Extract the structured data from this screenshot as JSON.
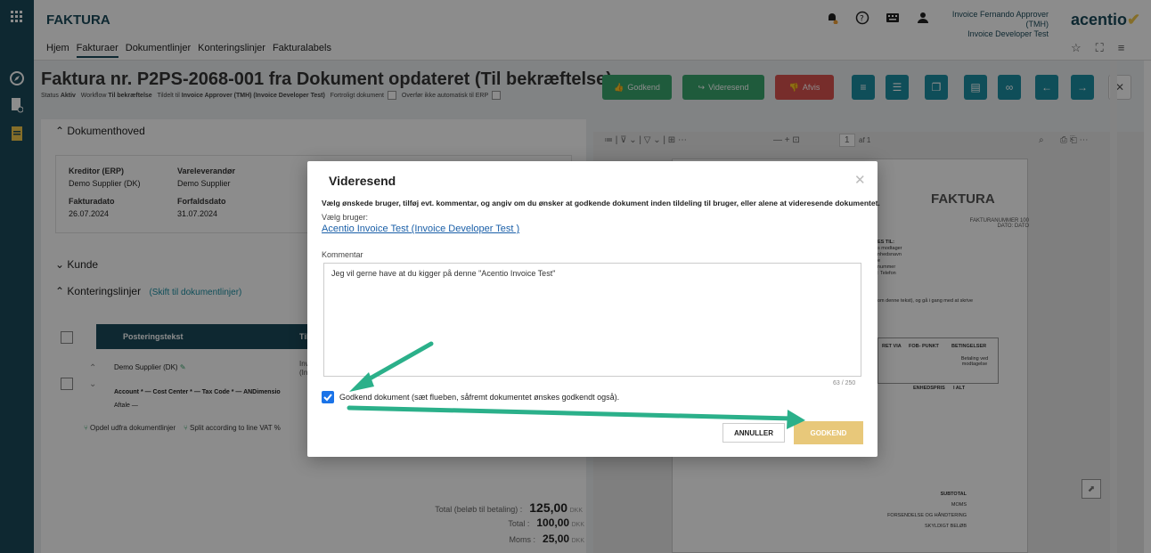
{
  "app": {
    "title": "FAKTURA",
    "logo_main": "acentio",
    "user_line1": "Invoice Fernando Approver (TMH)",
    "user_line2": "Invoice Developer Test"
  },
  "nav": [
    "Hjem",
    "Fakturaer",
    "Dokumentlinjer",
    "Konteringslinjer",
    "Fakturalabels"
  ],
  "doc": {
    "title": "Faktura nr. P2PS-2068-001 fra Dokument opdateret (Til bekræftelse)",
    "status_label": "Status",
    "status_value": "Aktiv",
    "workflow_label": "Workflow",
    "workflow_value": "Til bekræftelse",
    "assigned_label": "Tildelt til",
    "assigned_value": "Invoice Approver (TMH) (Invoice Developer Test)",
    "confidential": "Fortroligt dokument",
    "no_erp": "Overfør ikke automatisk til ERP"
  },
  "toolbar": {
    "approve": "Godkend",
    "forward": "Videresend",
    "reject": "Afvis"
  },
  "header_section": {
    "title": "Dokumenthoved",
    "creditor_label": "Kreditor (ERP)",
    "creditor_value": "Demo Supplier (DK)",
    "supplier_label": "Vareleverandør",
    "supplier_value": "Demo Supplier",
    "invoice_date_label": "Fakturadato",
    "invoice_date_value": "26.07.2024",
    "due_date_label": "Forfaldsdato",
    "due_date_value": "31.07.2024"
  },
  "customer_section": {
    "title": "Kunde"
  },
  "lines_section": {
    "title": "Konteringslinjer",
    "switch_link": "(Skift til dokumentlinjer)",
    "col_posting": "Posteringstekst",
    "col_tild": "Tild",
    "row_text": "Demo Supplier (DK)",
    "row_inv1": "Invo",
    "row_inv2": "(Invo",
    "row_fields": "Account * — Cost Center * — Tax Code * — ANDimensio",
    "row_aftale": "Aftale —",
    "split1": "Opdel udfra dokumentlinjer",
    "split2": "Split according to line VAT %"
  },
  "totals": {
    "total_label": "Total :",
    "total_value": "100,00",
    "total_cur": "DKK",
    "vat_label": "Moms :",
    "vat_value": "25,00",
    "vat_cur": "DKK",
    "grand_label": "Total (beløb til betaling) :",
    "grand_value": "125,00",
    "grand_cur": "DKK"
  },
  "pdf": {
    "page": "1",
    "of": "af 1",
    "heading": "FAKTURA",
    "invoice_no": "FAKTURANUMMER 100",
    "date": "DATO: DATO",
    "ship_label": "ES TIL:",
    "ship_lines": [
      "s modtager",
      "nhedsnavn",
      "e",
      "nummer",
      ": Telefon"
    ],
    "note": "om denne tekst), og gå i gang med at skrive",
    "col_via": "RET VIA",
    "col_fob": "FOB- PUNKT",
    "col_terms": "BETINGELSER",
    "terms_value": "Betaling ved modtagelse",
    "col_unit": "ENHEDSPRIS",
    "col_total": "I ALT",
    "subtotal": "SUBTOTAL",
    "moms": "MOMS",
    "shipping": "FORSENDELSE OG HÅNDTERING",
    "due": "SKYLDIGT BELØB"
  },
  "modal": {
    "title": "Videresend",
    "instruction": "Vælg ønskede bruger, tilføj evt. kommentar, og angiv om du ønsker at godkende dokument inden tildeling til bruger, eller alene at videresende dokumentet.",
    "user_label": "Vælg bruger:",
    "user_value": "Acentio Invoice Test (Invoice Developer Test )",
    "comment_label": "Kommentar",
    "comment_value": "Jeg vil gerne have at du kigger på denne \"Acentio Invoice Test\"",
    "counter": "63 / 250",
    "approve_check_label": "Godkend dokument (sæt flueben, såfremt dokumentet ønskes godkendt også).",
    "cancel": "ANNULLER",
    "ok": "GODKEND"
  },
  "colors": {
    "brand": "#1b4a5a",
    "approve": "#3aa76d",
    "reject": "#d9534f",
    "icon_btn": "#1c8fa3",
    "ok_btn": "#e8c87a",
    "arrow": "#2bb08a"
  }
}
